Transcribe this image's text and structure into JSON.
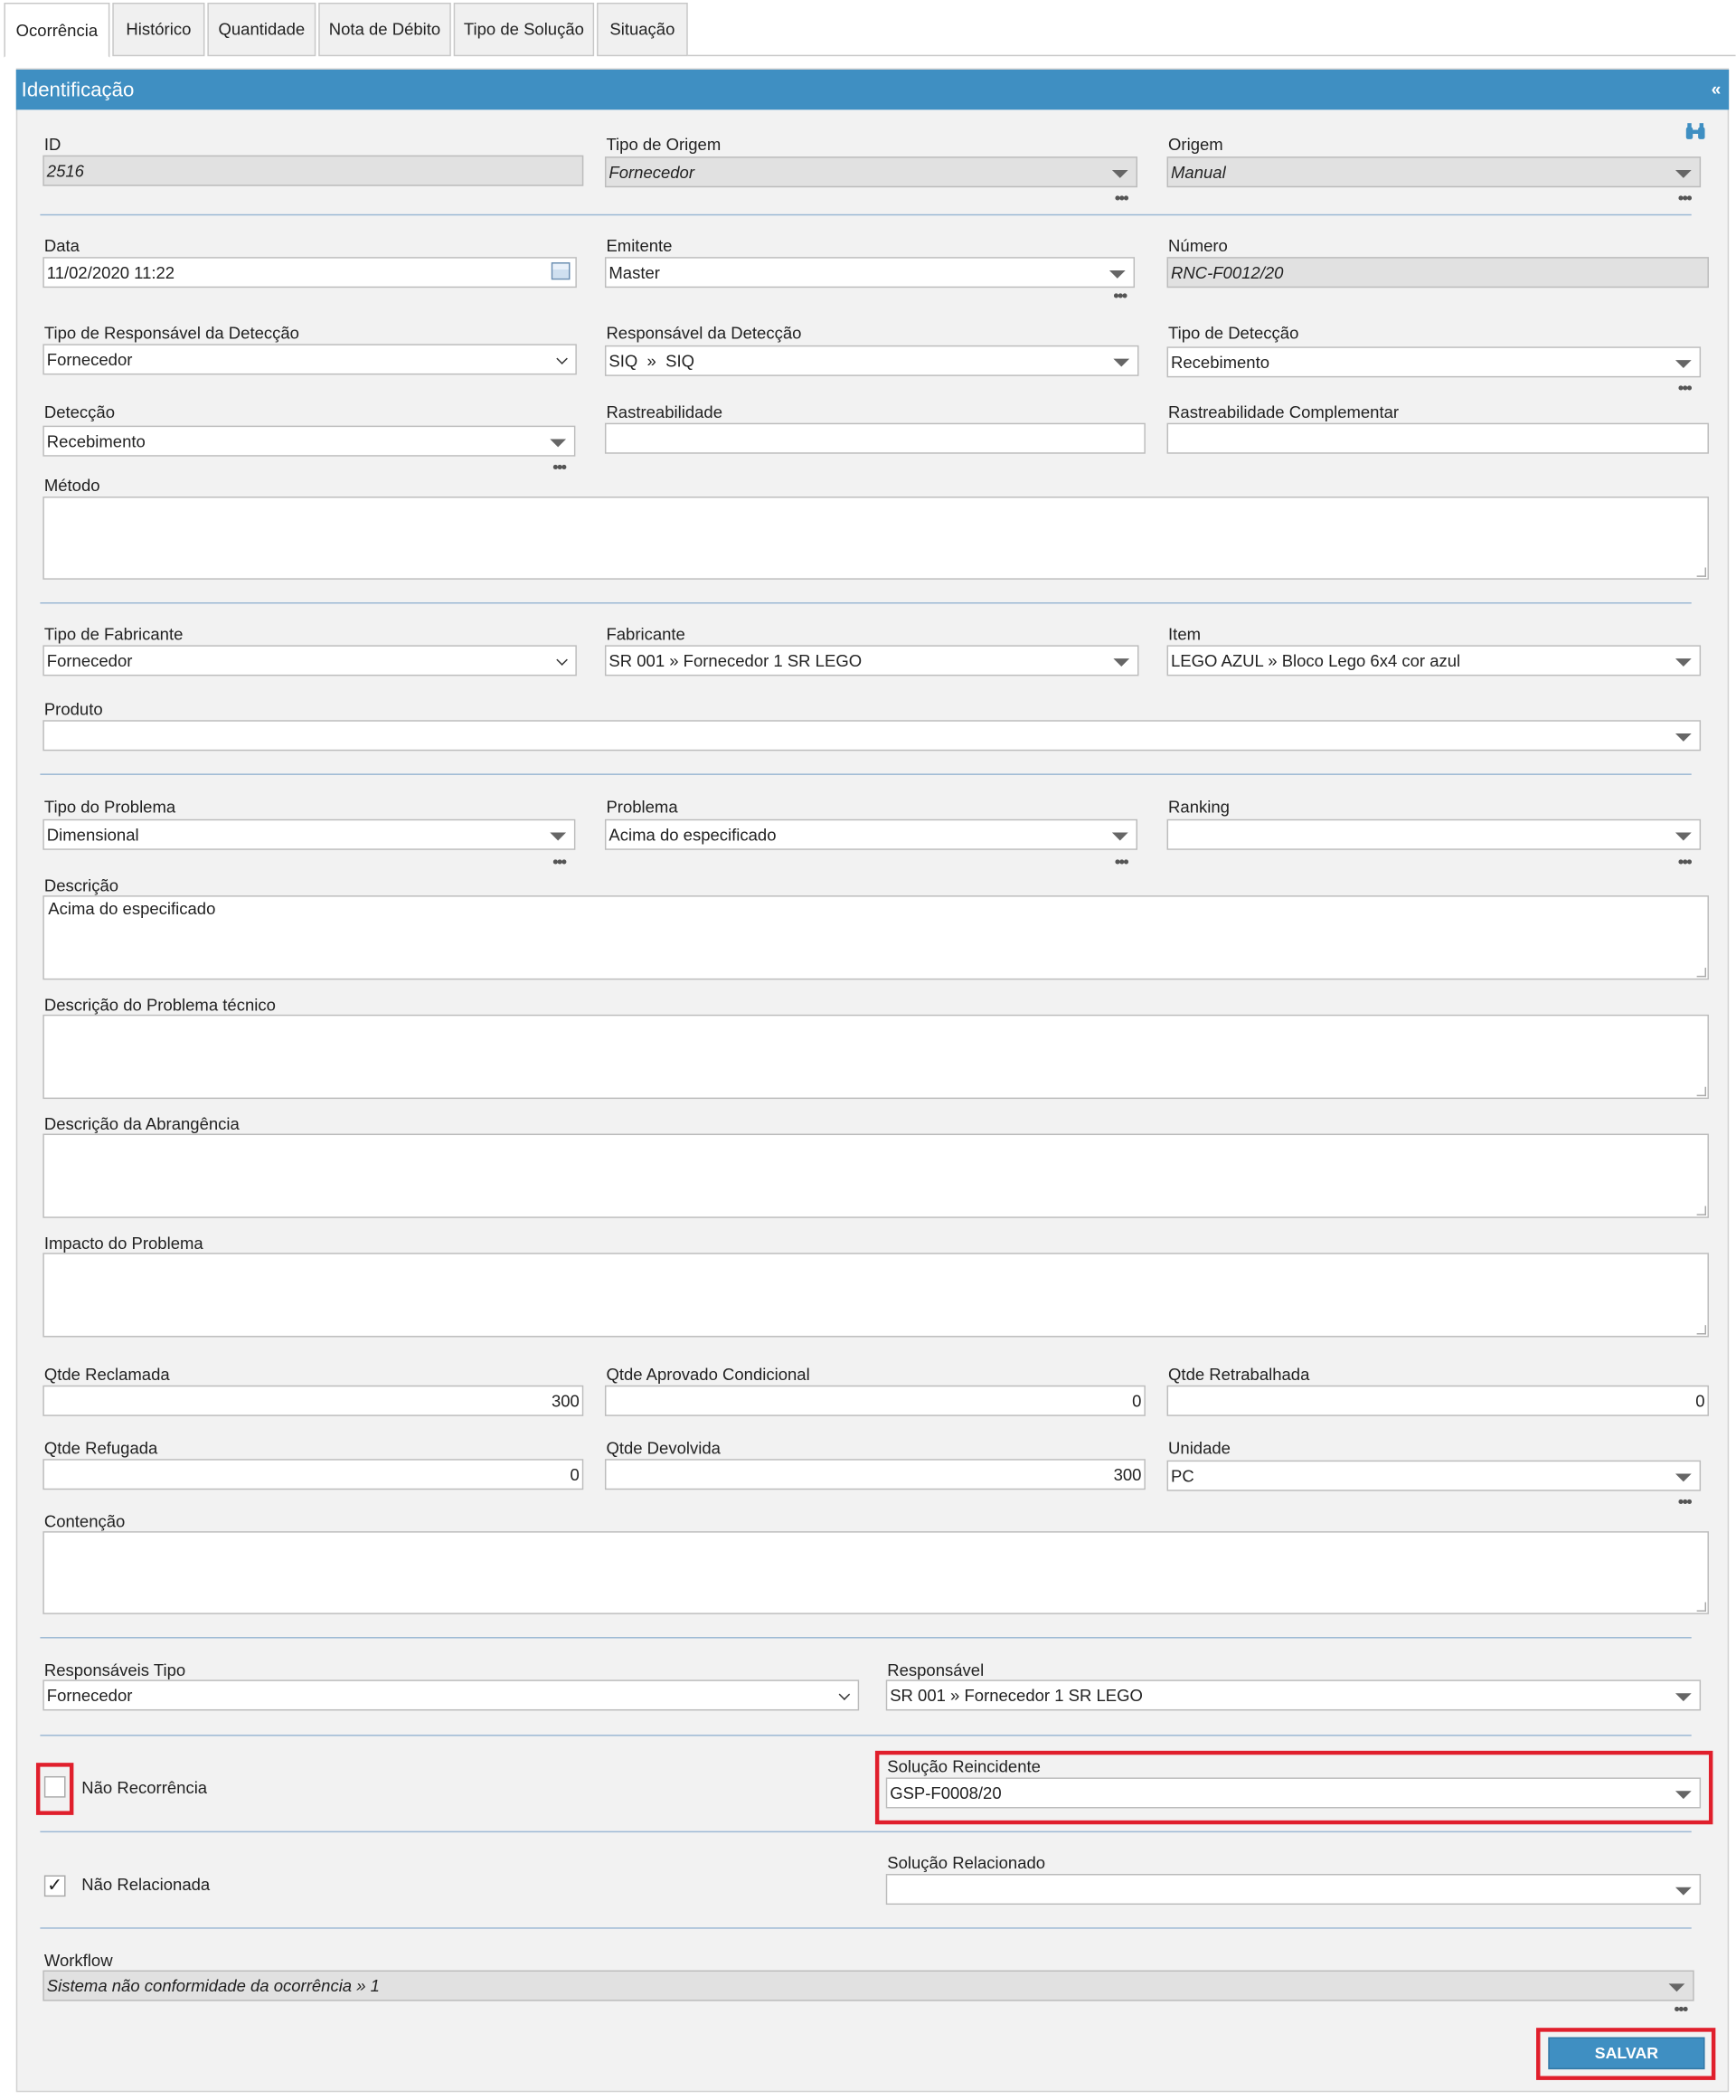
{
  "tabs": [
    "Ocorrência",
    "Histórico",
    "Quantidade",
    "Nota de Débito",
    "Tipo de Solução",
    "Situação"
  ],
  "section": {
    "title": "Identificação",
    "collapse": "«"
  },
  "fields": {
    "id": {
      "label": "ID",
      "value": "2516"
    },
    "tipo_origem": {
      "label": "Tipo de Origem",
      "value": "Fornecedor"
    },
    "origem": {
      "label": "Origem",
      "value": "Manual"
    },
    "data": {
      "label": "Data",
      "value": "11/02/2020 11:22"
    },
    "emitente": {
      "label": "Emitente",
      "value": "Master"
    },
    "numero": {
      "label": "Número",
      "value": "RNC-F0012/20"
    },
    "tipo_resp_deteccao": {
      "label": "Tipo de Responsável da Detecção",
      "value": "Fornecedor"
    },
    "resp_deteccao": {
      "label": "Responsável da Detecção",
      "value": "SIQ  »  SIQ"
    },
    "tipo_deteccao": {
      "label": "Tipo de Detecção",
      "value": "Recebimento"
    },
    "deteccao": {
      "label": "Detecção",
      "value": "Recebimento"
    },
    "rastreabilidade": {
      "label": "Rastreabilidade",
      "value": ""
    },
    "rastreabilidade_comp": {
      "label": "Rastreabilidade Complementar",
      "value": ""
    },
    "metodo": {
      "label": "Método",
      "value": ""
    },
    "tipo_fabricante": {
      "label": "Tipo de Fabricante",
      "value": "Fornecedor"
    },
    "fabricante": {
      "label": "Fabricante",
      "value": "SR 001 » Fornecedor 1 SR LEGO"
    },
    "item": {
      "label": "Item",
      "value": "LEGO AZUL » Bloco Lego 6x4 cor azul"
    },
    "produto": {
      "label": "Produto",
      "value": ""
    },
    "tipo_problema": {
      "label": "Tipo do Problema",
      "value": "Dimensional"
    },
    "problema": {
      "label": "Problema",
      "value": "Acima do especificado"
    },
    "ranking": {
      "label": "Ranking",
      "value": ""
    },
    "descricao": {
      "label": "Descrição",
      "value": "Acima do especificado"
    },
    "desc_problema_tecnico": {
      "label": "Descrição do Problema técnico",
      "value": ""
    },
    "desc_abrangencia": {
      "label": "Descrição da Abrangência",
      "value": ""
    },
    "impacto": {
      "label": "Impacto do Problema",
      "value": ""
    },
    "qtde_reclamada": {
      "label": "Qtde Reclamada",
      "value": "300"
    },
    "qtde_aprov_cond": {
      "label": "Qtde Aprovado Condicional",
      "value": "0"
    },
    "qtde_retrabalhada": {
      "label": "Qtde Retrabalhada",
      "value": "0"
    },
    "qtde_refugada": {
      "label": "Qtde Refugada",
      "value": "0"
    },
    "qtde_devolvida": {
      "label": "Qtde Devolvida",
      "value": "300"
    },
    "unidade": {
      "label": "Unidade",
      "value": "PC"
    },
    "contencao": {
      "label": "Contenção",
      "value": ""
    },
    "responsaveis_tipo": {
      "label": "Responsáveis Tipo",
      "value": "Fornecedor"
    },
    "responsavel": {
      "label": "Responsável",
      "value": "SR 001 » Fornecedor 1 SR LEGO"
    },
    "nao_recorrencia": {
      "label": "Não Recorrência",
      "checked": false
    },
    "solucao_reincidente": {
      "label": "Solução Reincidente",
      "value": "GSP-F0008/20"
    },
    "nao_relacionada": {
      "label": "Não Relacionada",
      "checked": true,
      "mark": "✓"
    },
    "solucao_relacionado": {
      "label": "Solução Relacionado",
      "value": ""
    },
    "workflow": {
      "label": "Workflow",
      "value": "Sistema não conformidade da ocorrência » 1"
    }
  },
  "more_glyph": "•••",
  "save_label": "SALVAR",
  "colors": {
    "header": "#3f8fc2",
    "highlight": "#e01f2c",
    "button": "#3f8fc2"
  }
}
